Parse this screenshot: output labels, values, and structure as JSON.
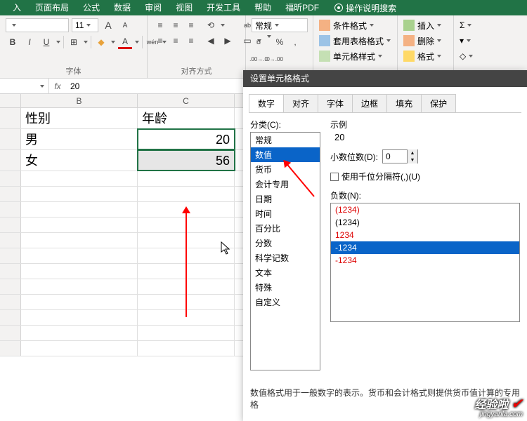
{
  "ribbon_tabs": [
    "入",
    "页面布局",
    "公式",
    "数据",
    "审阅",
    "视图",
    "开发工具",
    "帮助",
    "福昕PDF"
  ],
  "tell_me": "操作说明搜索",
  "font": {
    "size": "11",
    "A_up": "A",
    "A_dn": "A",
    "B": "B",
    "I": "I",
    "U": "U",
    "border": "⊞",
    "fill": "◆",
    "color": "A",
    "py": "wén",
    "group": "字体"
  },
  "align": {
    "wrap": "ab",
    "merge": "▭",
    "group": "对齐方式"
  },
  "number": {
    "format": "常规",
    "cur": "¤",
    "pct": "%",
    "comma": ",",
    "inc": ".00→.0",
    "dec": ".0→.00"
  },
  "styles": {
    "cond": "条件格式",
    "tbl": "套用表格格式",
    "cell": "单元格样式"
  },
  "cells": {
    "ins": "插入",
    "del": "删除",
    "fmt": "格式"
  },
  "edit": {
    "sum": "Σ",
    "fill": "▾",
    "clear": "◇"
  },
  "formula": {
    "name": "",
    "value": "20"
  },
  "grid": {
    "cols": [
      "B",
      "C"
    ],
    "rows": [
      {
        "b": "性别",
        "c": "年龄"
      },
      {
        "b": "男",
        "c": "20"
      },
      {
        "b": "女",
        "c": "56"
      }
    ]
  },
  "dialog": {
    "title": "设置单元格格式",
    "tabs": [
      "数字",
      "对齐",
      "字体",
      "边框",
      "填充",
      "保护"
    ],
    "cat_label": "分类(C):",
    "cats": [
      "常规",
      "数值",
      "货币",
      "会计专用",
      "日期",
      "时间",
      "百分比",
      "分数",
      "科学记数",
      "文本",
      "特殊",
      "自定义"
    ],
    "example_lbl": "示例",
    "example_val": "20",
    "decimals_lbl": "小数位数(D):",
    "decimals_val": "0",
    "thou_lbl": "使用千位分隔符(,)(U)",
    "neg_lbl": "负数(N):",
    "negs": [
      "(1234)",
      "(1234)",
      "1234",
      "-1234",
      "-1234"
    ],
    "note": "数值格式用于一般数字的表示。货币和会计格式则提供货币值计算的专用格"
  },
  "watermark": {
    "big": "经验啦",
    "sm": "jingyanla.com"
  }
}
